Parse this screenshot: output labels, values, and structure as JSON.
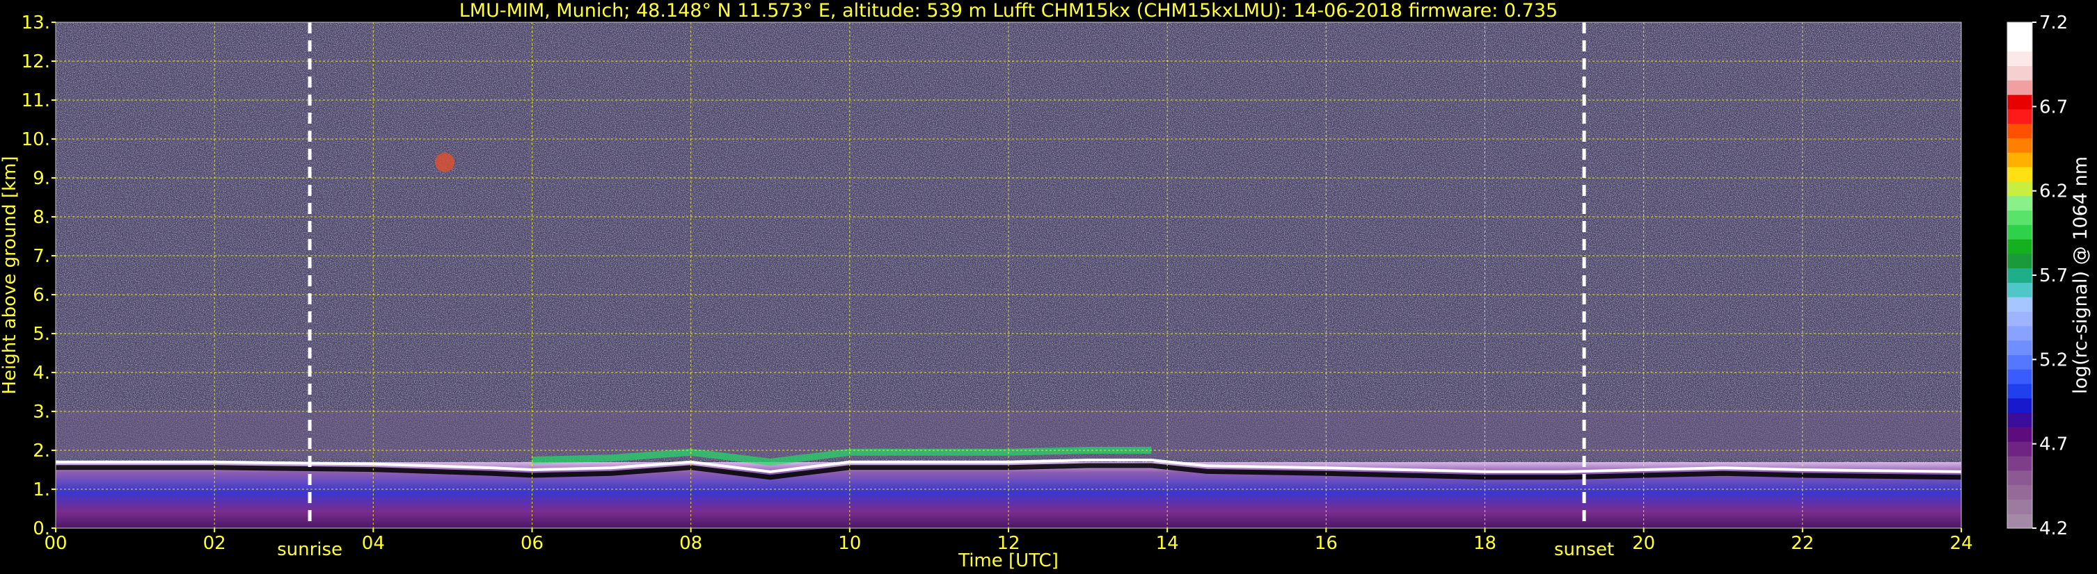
{
  "chart_data": {
    "type": "heatmap",
    "title": "LMU-MIM, Munich; 48.148° N 11.573° E, altitude: 539 m    Lufft CHM15kx (CHM15kxLMU): 14-06-2018    firmware: 0.735",
    "xlabel": "Time [UTC]",
    "ylabel": "Height above ground [km]",
    "xlim": [
      0,
      24
    ],
    "ylim": [
      0,
      13
    ],
    "x_ticks": [
      "00",
      "02",
      "04",
      "06",
      "08",
      "10",
      "12",
      "14",
      "16",
      "18",
      "20",
      "22",
      "24"
    ],
    "y_ticks": [
      "0.",
      "1.",
      "2.",
      "3.",
      "4.",
      "5.",
      "6.",
      "7.",
      "8.",
      "9.",
      "10.",
      "11.",
      "12.",
      "13."
    ],
    "grid": true,
    "colorbar": {
      "label": "log(rc-signal) @ 1064 nm",
      "range": [
        4.2,
        7.2
      ],
      "ticks": [
        "4.2",
        "4.7",
        "5.2",
        "5.7",
        "6.2",
        "6.7",
        "7.2"
      ]
    },
    "markers": [
      {
        "label": "sunrise",
        "x": 3.2
      },
      {
        "label": "sunset",
        "x": 19.25
      }
    ],
    "features": [
      {
        "name": "boundary layer top",
        "x": [
          0,
          2,
          4,
          5.5,
          6,
          7,
          8,
          9,
          10,
          11,
          12,
          13,
          13.8,
          14.5,
          16,
          17,
          18,
          19,
          20,
          21,
          22,
          24
        ],
        "y": [
          1.7,
          1.7,
          1.65,
          1.55,
          1.5,
          1.55,
          1.7,
          1.45,
          1.7,
          1.7,
          1.7,
          1.75,
          1.75,
          1.6,
          1.55,
          1.5,
          1.45,
          1.45,
          1.5,
          1.55,
          1.5,
          1.45
        ]
      },
      {
        "name": "cirrus patch",
        "x": 4.9,
        "y": 9.4
      }
    ]
  }
}
